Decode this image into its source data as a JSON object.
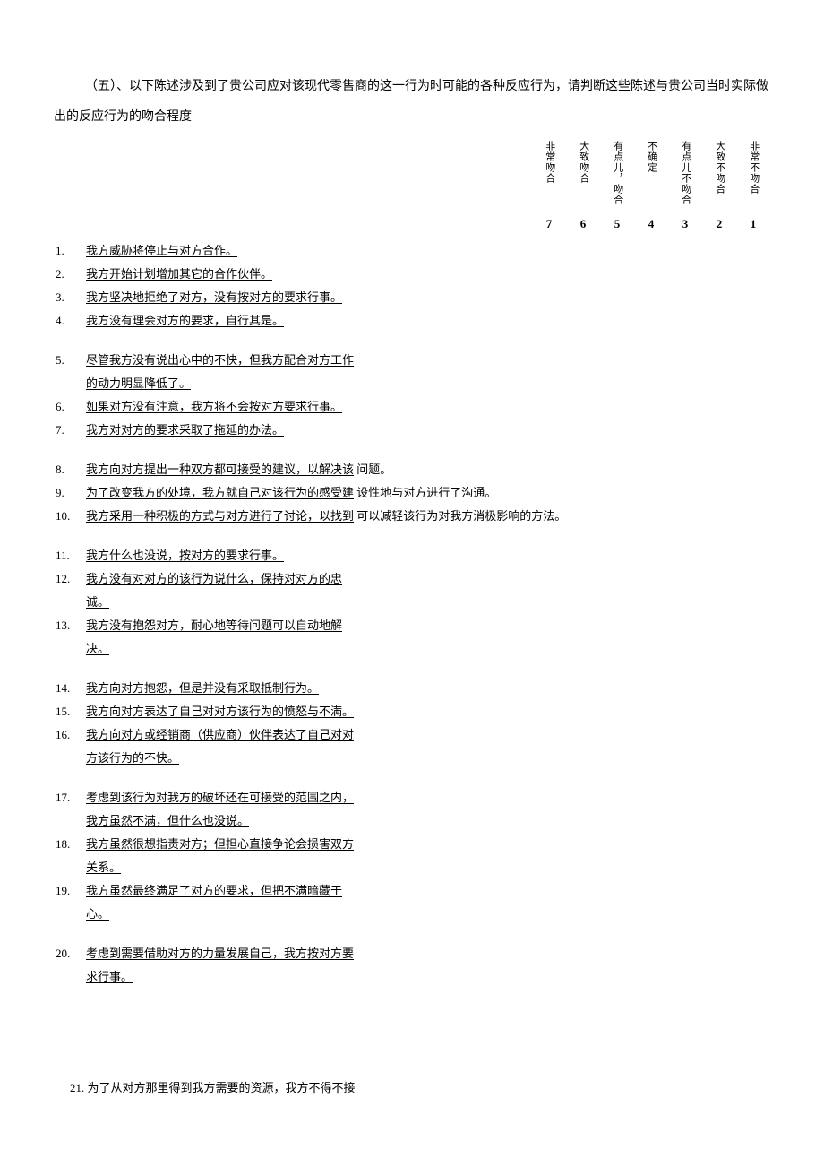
{
  "intro": "（五）、以下陈述涉及到了贵公司应对该现代零售商的这一行为时可能的各种反应行为，请判断这些陈述与贵公司当时实际做出的反应行为的吻合程度",
  "scale": [
    {
      "label": "非常吻合",
      "num": "7"
    },
    {
      "label": "大致吻合",
      "num": "6"
    },
    {
      "label": "有点儿，吻合",
      "num": "5"
    },
    {
      "label": "不确定",
      "num": "4"
    },
    {
      "label": "有点儿不吻合",
      "num": "3"
    },
    {
      "label": "大致不吻合",
      "num": "2"
    },
    {
      "label": "非常不吻合",
      "num": "1"
    }
  ],
  "groups": [
    [
      {
        "n": "1.",
        "t": "我方威胁将停止与对方合作。"
      },
      {
        "n": "2.",
        "t": " 我方开始计划增加其它的合作伙伴。"
      },
      {
        "n": "3.",
        "t": "我方坚决地拒绝了对方，没有按对方的要求行事。"
      },
      {
        "n": "4.",
        "t": "我方没有理会对方的要求，自行其是。"
      }
    ],
    [
      {
        "n": "5.",
        "t": "尽管我方没有说出心中的不快，但我方配合对方工作",
        "cont": "的动力明显降低了。"
      },
      {
        "n": "6.",
        "t": "如果对方没有注意，我方将不会按对方要求行事。"
      },
      {
        "n": "7.",
        "t": "我方对对方的要求采取了拖延的办法。"
      }
    ],
    [
      {
        "n": "8.",
        "t": "我方向对方提出一种双方都可接受的建议，以解决该",
        "tail": " 问题。"
      },
      {
        "n": "9.",
        "t": "为了改变我方的处境，我方就自己对该行为的感受建",
        "tail": " 设性地与对方进行了沟通。"
      },
      {
        "n": "10.",
        "t": "我方采用一种积极的方式与对方进行了讨论，以找到",
        "tail": " 可以减轻该行为对我方消极影响的方法。"
      }
    ],
    [
      {
        "n": "11.",
        "t": "我方什么也没说，按对方的要求行事。"
      },
      {
        "n": "12.",
        "t": "我方没有对对方的该行为说什么，保持对对方的忠",
        "cont": "诚。"
      },
      {
        "n": "13.",
        "t": "我方没有抱怨对方，耐心地等待问题可以自动地解",
        "cont": "决。"
      }
    ],
    [
      {
        "n": "14.",
        "t": "我方向对方抱怨，但是并没有采取抵制行为。"
      },
      {
        "n": "15.",
        "t": "我方向对方表达了自己对对方该行为的愤怒与不满。"
      },
      {
        "n": "16.",
        "t": "我方向对方或经销商（供应商）伙伴表达了自己对对",
        "cont": "方该行为的不快。"
      }
    ],
    [
      {
        "n": "17.",
        "t": "考虑到该行为对我方的破坏还在可接受的范围之内，",
        "cont": "我方虽然不满，但什么也没说。"
      },
      {
        "n": "18.",
        "t": "我方虽然很想指责对方；但担心直接争论会损害双方",
        "cont": "关系。"
      },
      {
        "n": "19.",
        "t": "我方虽然最终满足了对方的要求，但把不满暗藏于",
        "cont": "心。"
      }
    ],
    [
      {
        "n": "20.",
        "t": " 考虑到需要借助对方的力量发展自己，我方按对方要",
        "cont": "求行事。"
      }
    ]
  ],
  "isolated": {
    "n": "21.",
    "t": "为了从对方那里得到我方需要的资源，我方不得不接"
  }
}
